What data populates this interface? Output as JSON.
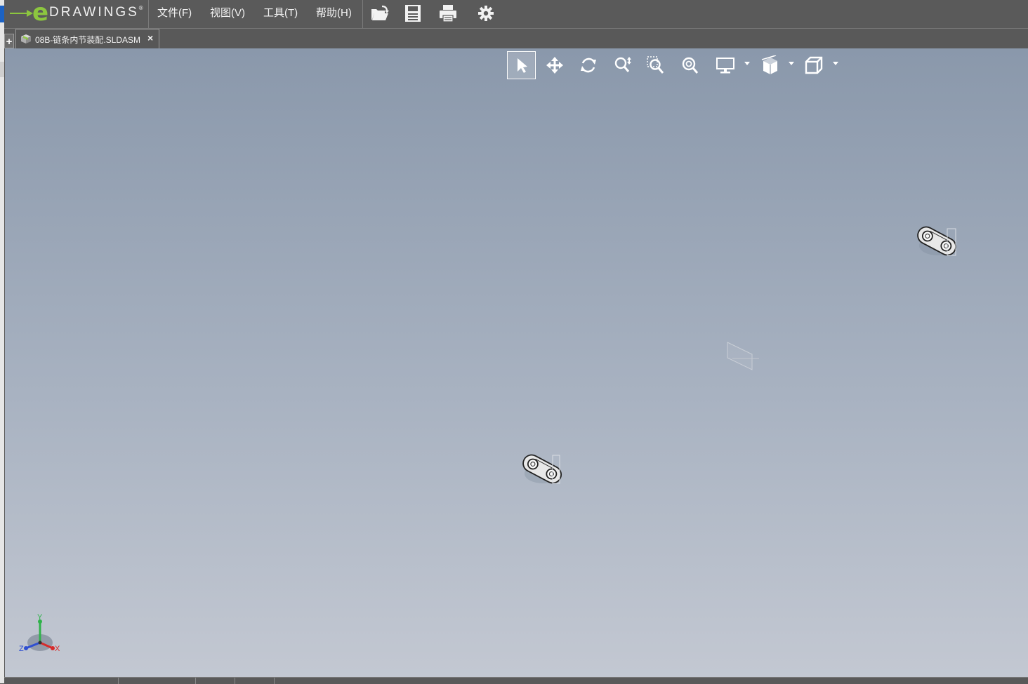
{
  "app": {
    "logo_letter": "e",
    "logo_word": "DRAWINGS",
    "logo_reg": "®"
  },
  "menu": [
    {
      "label": "文件(F)"
    },
    {
      "label": "视图(V)"
    },
    {
      "label": "工具(T)"
    },
    {
      "label": "帮助(H)"
    }
  ],
  "toolbar_icons": [
    "open-icon",
    "save-icon",
    "print-icon",
    "settings-gear-icon"
  ],
  "tab": {
    "plus_label": "+",
    "document": "08B-链条内节装配.SLDASM",
    "close": "×"
  },
  "view_tools": [
    "select-arrow-icon",
    "pan-move-icon",
    "rotate-icon",
    "zoom-icon",
    "zoom-to-area-icon",
    "zoom-to-fit-icon",
    "display-style-icon",
    "section-view-icon",
    "standard-views-cube-icon"
  ],
  "triad": {
    "y": "Y",
    "z": "Z",
    "x": "X"
  },
  "colors": {
    "accent": "#8cc63f",
    "chrome": "#5a5a5a",
    "viewport_top": "#8a98ab",
    "viewport_bottom": "#c3c8d2"
  }
}
